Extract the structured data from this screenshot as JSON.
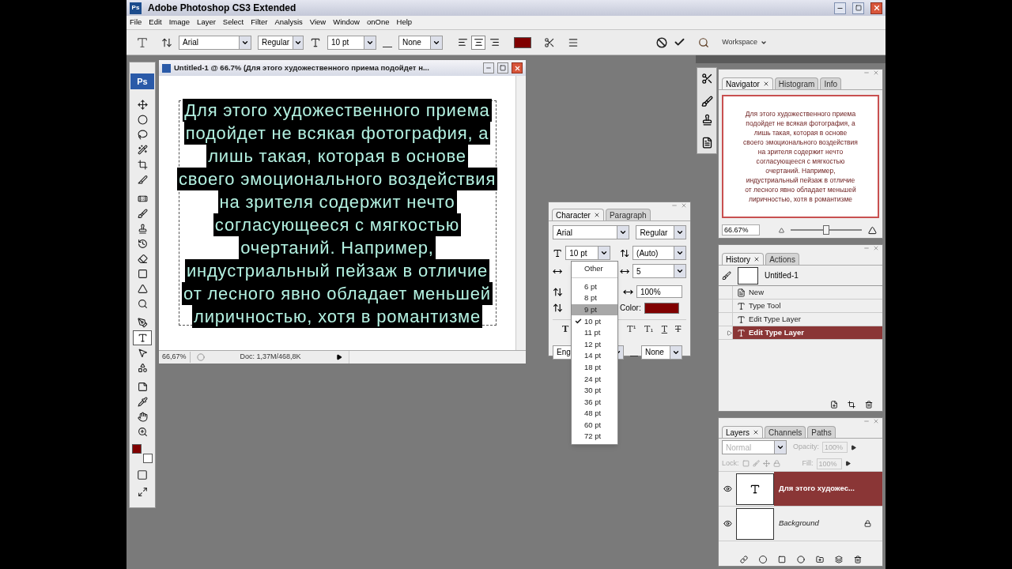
{
  "window": {
    "title": "Adobe Photoshop CS3 Extended",
    "app_icon": "Ps"
  },
  "menu": [
    "File",
    "Edit",
    "Image",
    "Layer",
    "Select",
    "Filter",
    "Analysis",
    "View",
    "Window",
    "onOne",
    "Help"
  ],
  "options_bar": {
    "font": "Arial",
    "style": "Regular",
    "size": "10 pt",
    "antialias": "None",
    "align": [
      {
        "kind": "left",
        "selected": false
      },
      {
        "kind": "center",
        "selected": true
      },
      {
        "kind": "right",
        "selected": false
      }
    ],
    "color": "#800000",
    "workspace": "Workspace"
  },
  "toolbox": {
    "logo": "Ps",
    "swatches": [
      {
        "kind": "foreground",
        "color": "#800000"
      },
      {
        "kind": "background",
        "color": "#ffffff"
      }
    ],
    "tools": [
      {
        "kind": "move",
        "selected": false
      },
      {
        "kind": "marquee",
        "selected": false
      },
      {
        "kind": "lasso",
        "selected": false
      },
      {
        "kind": "wand",
        "selected": false
      },
      {
        "kind": "crop",
        "selected": false
      },
      {
        "kind": "slice",
        "selected": false
      },
      {
        "kind": "healing",
        "selected": false
      },
      {
        "kind": "brush",
        "selected": false
      },
      {
        "kind": "stamp",
        "selected": false
      },
      {
        "kind": "history_brush",
        "selected": false
      },
      {
        "kind": "eraser",
        "selected": false
      },
      {
        "kind": "gradient",
        "selected": false
      },
      {
        "kind": "blur",
        "selected": false
      },
      {
        "kind": "dodge",
        "selected": false
      },
      {
        "kind": "pen",
        "selected": false
      },
      {
        "kind": "type",
        "selected": true
      },
      {
        "kind": "path_select",
        "selected": false
      },
      {
        "kind": "shape",
        "selected": false
      },
      {
        "kind": "notes",
        "selected": false
      },
      {
        "kind": "eyedropper",
        "selected": false
      },
      {
        "kind": "hand",
        "selected": false
      },
      {
        "kind": "zoom",
        "selected": false
      }
    ]
  },
  "document": {
    "title": "Untitled-1 @ 66.7% (Для этого художественного приема подойдет н...",
    "zoom": "66,67%",
    "doc_info": "Doc: 1,37M/468,8K",
    "lines": [
      "Для этого художественного приема",
      "подойдет не всякая фотография, а",
      "лишь такая, которая в основе",
      "своего эмоционального воздействия",
      "на зрителя содержит нечто",
      "согласующееся с мягкостью",
      "очертаний. Например,",
      "индустриальный пейзаж в отличие",
      "от лесного явно обладает меньшей",
      "лиричностью, хотя в романтизме"
    ]
  },
  "character": {
    "tabs": [
      {
        "label": "Character",
        "selected": true
      },
      {
        "label": "Paragraph",
        "selected": false
      }
    ],
    "font": "Arial",
    "style": "Regular",
    "size": "10 pt",
    "leading": "(Auto)",
    "tracking": "5",
    "horizontal_scale": "100%",
    "color_label": "Color:",
    "color": "#800000",
    "language": "Eng",
    "antialias": "None",
    "style_buttons": [
      {
        "kind": "bold",
        "label": "T"
      },
      {
        "kind": "superscript",
        "label": "T¹"
      },
      {
        "kind": "subscript",
        "label": "T₁"
      },
      {
        "kind": "underline",
        "label": "T"
      },
      {
        "kind": "strikethrough",
        "label": "T"
      }
    ],
    "size_menu": [
      {
        "label": "Other",
        "checked": false,
        "selected": false
      },
      {
        "label": "6 pt",
        "checked": false,
        "selected": false
      },
      {
        "label": "8 pt",
        "checked": false,
        "selected": false
      },
      {
        "label": "9 pt",
        "checked": false,
        "selected": true
      },
      {
        "label": "10 pt",
        "checked": true,
        "selected": false
      },
      {
        "label": "11 pt",
        "checked": false,
        "selected": false
      },
      {
        "label": "12 pt",
        "checked": false,
        "selected": false
      },
      {
        "label": "14 pt",
        "checked": false,
        "selected": false
      },
      {
        "label": "18 pt",
        "checked": false,
        "selected": false
      },
      {
        "label": "24 pt",
        "checked": false,
        "selected": false
      },
      {
        "label": "30 pt",
        "checked": false,
        "selected": false
      },
      {
        "label": "36 pt",
        "checked": false,
        "selected": false
      },
      {
        "label": "48 pt",
        "checked": false,
        "selected": false
      },
      {
        "label": "60 pt",
        "checked": false,
        "selected": false
      },
      {
        "label": "72 pt",
        "checked": false,
        "selected": false
      }
    ]
  },
  "navigator": {
    "tabs": [
      {
        "label": "Navigator",
        "selected": true
      },
      {
        "label": "Histogram",
        "selected": false
      },
      {
        "label": "Info",
        "selected": false
      }
    ],
    "zoom": "66.67%",
    "level": 0.5,
    "preview_lines": [
      "Для этого художественного приема",
      "подойдет не всякая фотография, а",
      "лишь такая, которая в основе",
      "своего эмоционального воздействия",
      "на зрителя содержит нечто",
      "согласующееся с мягкостью",
      "очертаний. Например,",
      "индустриальный пейзаж в отличие",
      "от лесного явно обладает меньшей",
      "лиричностью, хотя в романтизме"
    ]
  },
  "history": {
    "tabs": [
      {
        "label": "History",
        "selected": true
      },
      {
        "label": "Actions",
        "selected": false
      }
    ],
    "snapshot": "Untitled-1",
    "items": [
      {
        "label": "New",
        "kind": "document",
        "selected": false
      },
      {
        "label": "Type Tool",
        "kind": "type",
        "selected": false
      },
      {
        "label": "Edit Type Layer",
        "kind": "type",
        "selected": false
      },
      {
        "label": "Edit Type Layer",
        "kind": "type",
        "selected": true
      }
    ]
  },
  "layers": {
    "tabs": [
      {
        "label": "Layers",
        "selected": true
      },
      {
        "label": "Channels",
        "selected": false
      },
      {
        "label": "Paths",
        "selected": false
      }
    ],
    "blend_mode": "Normal",
    "opacity_label": "Opacity:",
    "opacity": "100%",
    "lock_label": "Lock:",
    "fill_label": "Fill:",
    "fill": "100%",
    "items": [
      {
        "name": "Для этого художес...",
        "kind": "text",
        "selected": true,
        "visible": true,
        "locked": false
      },
      {
        "name": "Background",
        "kind": "background",
        "selected": false,
        "visible": true,
        "locked": true
      }
    ]
  }
}
